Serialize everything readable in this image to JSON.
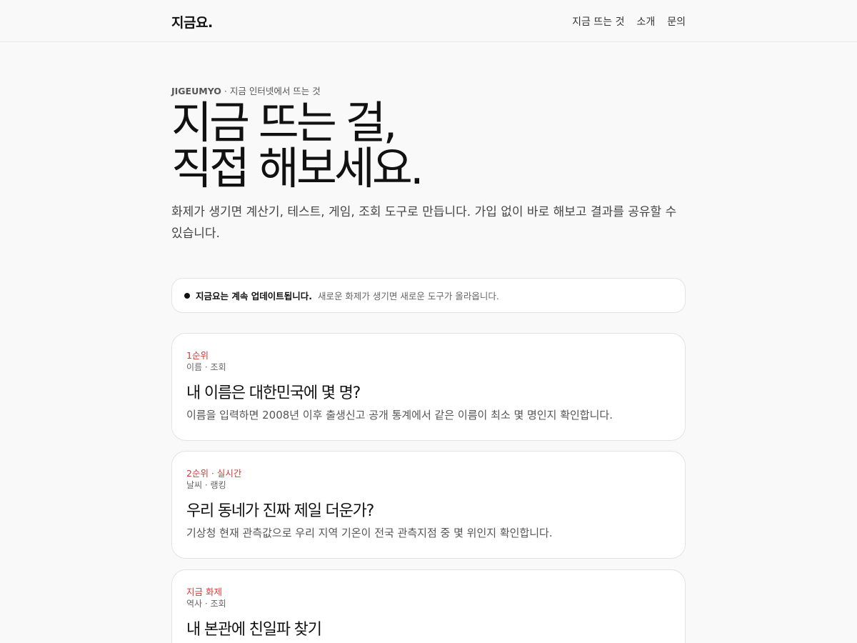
{
  "header": {
    "brand": "지금요.",
    "nav": [
      "지금 뜨는 것",
      "소개",
      "문의"
    ]
  },
  "hero": {
    "eyebrow_tag": "JIGEUMYO",
    "eyebrow_text": " · 지금 인터넷에서 뜨는 것",
    "headline_line1": "지금 뜨는 걸,",
    "headline_line2": "직접 해보세요.",
    "lead": "화제가 생기면 계산기, 테스트, 게임, 조회 도구로 만듭니다. 가입 없이 바로 해보고 결과를 공유할 수 있습니다."
  },
  "notice": {
    "strong": "지금요는 계속 업데이트됩니다.",
    "text": "새로운 화제가 생기면 새로운 도구가 올라옵니다."
  },
  "cards": [
    {
      "rank": "1순위",
      "category": "이름 · 조회",
      "title": "내 이름은 대한민국에 몇 명?",
      "desc": "이름을 입력하면 2008년 이후 출생신고 공개 통계에서 같은 이름이 최소 몇 명인지 확인합니다."
    },
    {
      "rank": "2순위 · 실시간",
      "category": "날씨 · 랭킹",
      "title": "우리 동네가 진짜 제일 더운가?",
      "desc": "기상청 현재 관측값으로 우리 지역 기온이 전국 관측지점 중 몇 위인지 확인합니다."
    },
    {
      "rank": "지금 화제",
      "category": "역사 · 조회",
      "title": "내 본관에 친일파 찾기",
      "desc": ""
    }
  ],
  "colors": {
    "accent": "#d23a3a",
    "background": "#f9f9f9"
  }
}
